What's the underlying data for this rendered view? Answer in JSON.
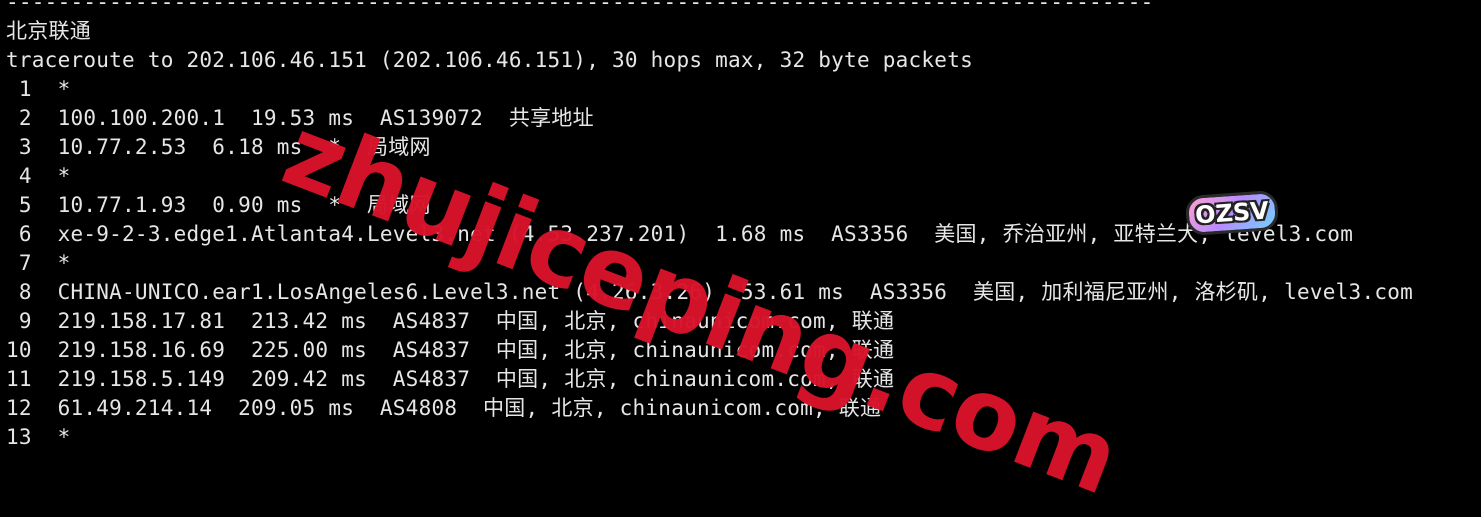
{
  "terminal": {
    "lines": [
      "-----------------------------------------------------------------------------------------",
      "北京联通",
      "traceroute to 202.106.46.151 (202.106.46.151), 30 hops max, 32 byte packets",
      " 1  *",
      " 2  100.100.200.1  19.53 ms  AS139072  共享地址",
      " 3  10.77.2.53  6.18 ms  *  局域网",
      " 4  *",
      " 5  10.77.1.93  0.90 ms  *  局域网",
      " 6  xe-9-2-3.edge1.Atlanta4.Level3.net (4.53.237.201)  1.68 ms  AS3356  美国, 乔治亚州, 亚特兰大, level3.com",
      " 7  *",
      " 8  CHINA-UNICO.ear1.LosAngeles6.Level3.net (4.26.3.26)  53.61 ms  AS3356  美国, 加利福尼亚州, 洛杉矶, level3.com",
      " 9  219.158.17.81  213.42 ms  AS4837  中国, 北京, chinaunicom.com, 联通",
      "10  219.158.16.69  225.00 ms  AS4837  中国, 北京, chinaunicom.com, 联通",
      "11  219.158.5.149  209.42 ms  AS4837  中国, 北京, chinaunicom.com, 联通",
      "12  61.49.214.14  209.05 ms  AS4808  中国, 北京, chinaunicom.com, 联通",
      "13  *"
    ]
  },
  "watermark": {
    "text": "zhujiceping.com",
    "color": "#d8132b"
  },
  "logo": {
    "text": "OZSV"
  },
  "colors": {
    "background": "#000000",
    "text": "#e6e6e6"
  }
}
